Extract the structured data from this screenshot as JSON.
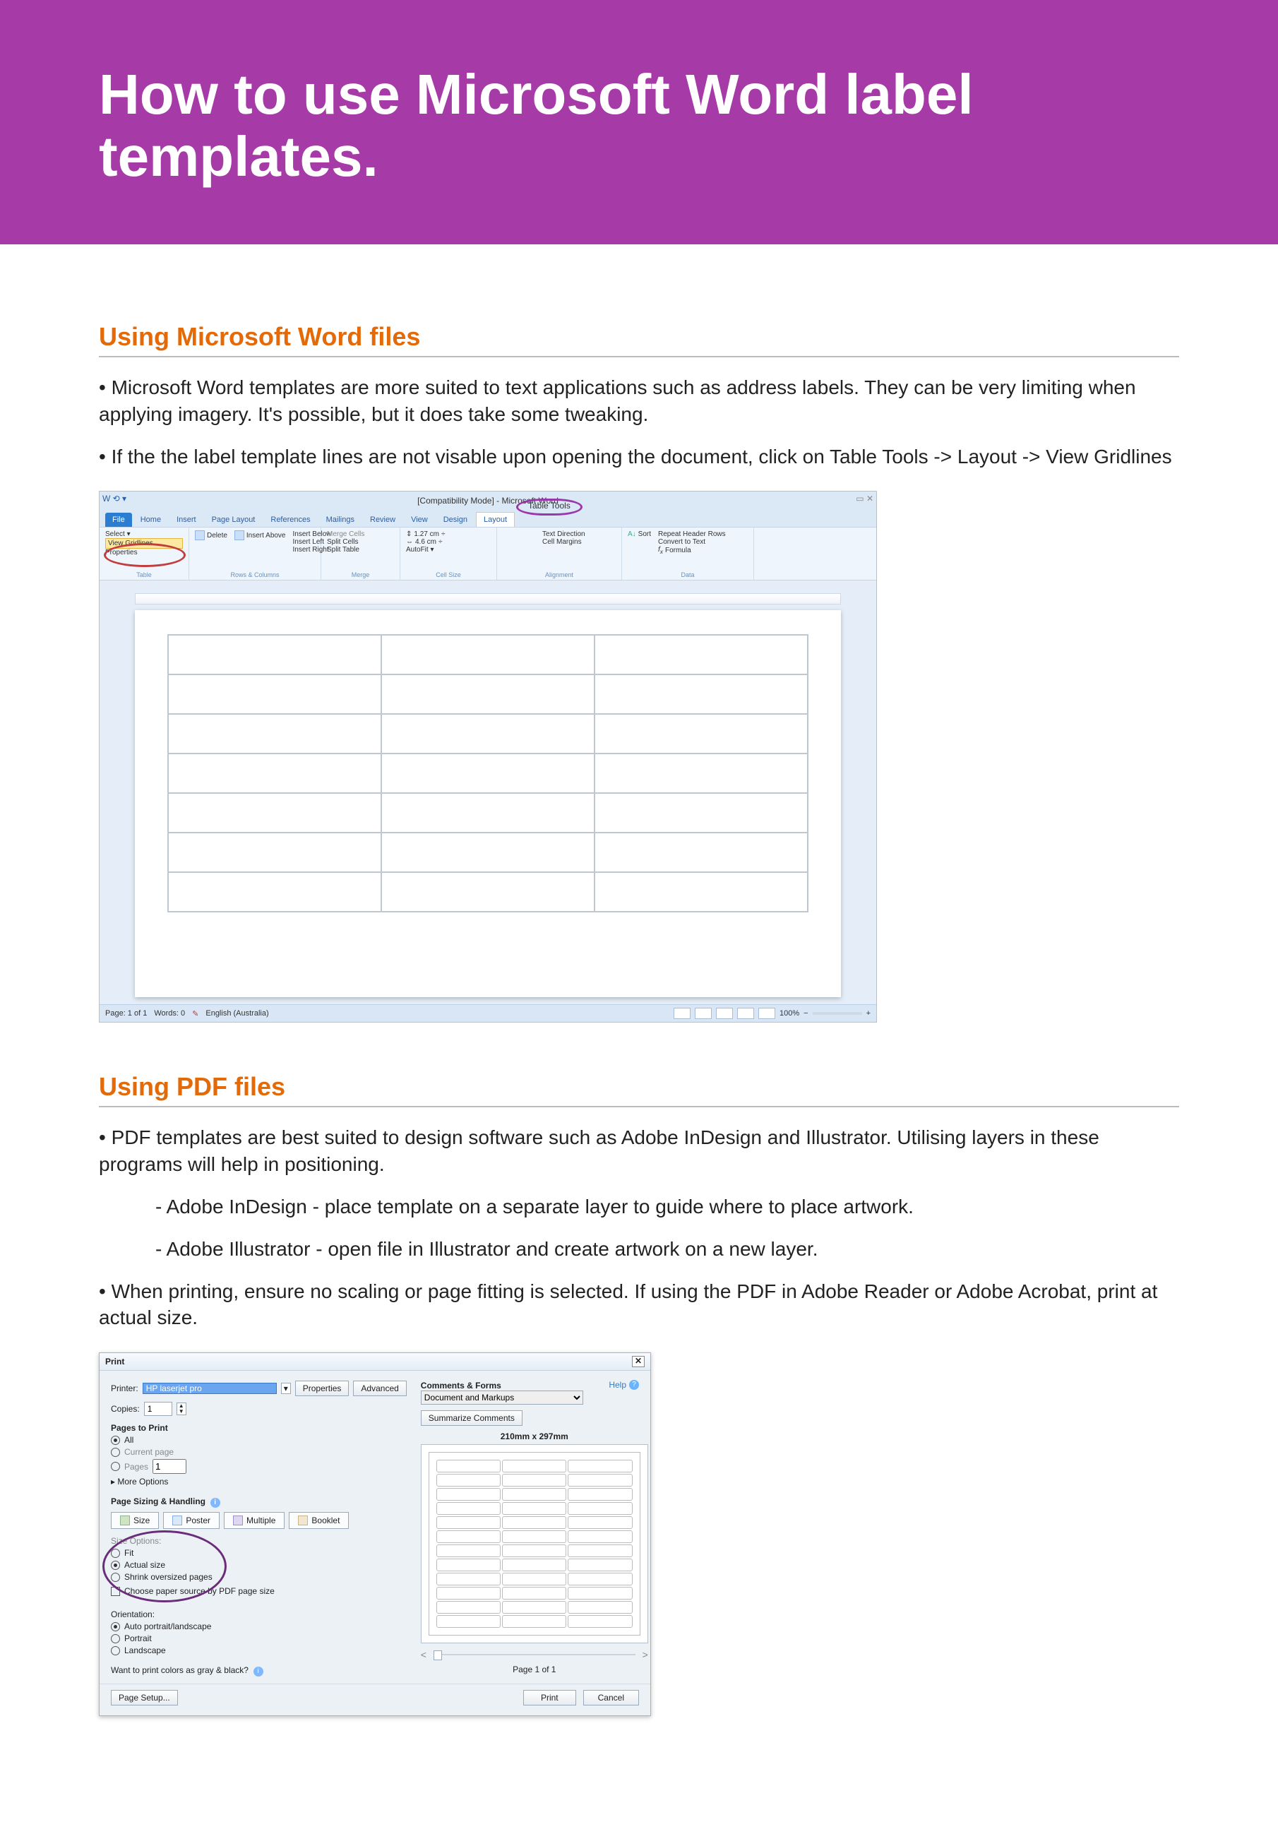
{
  "hero": {
    "title": "How to use Microsoft Word label templates."
  },
  "section1": {
    "heading": "Using Microsoft Word files",
    "p1": "• Microsoft Word templates are more suited to text applications such as address labels. They can be very limiting when applying imagery. It's possible, but it does take some tweaking.",
    "p2": "• If the the label template lines are not visable upon opening the document, click on Table Tools -> Layout -> View Gridlines"
  },
  "word": {
    "title": "[Compatibility Mode] - Microsoft Word",
    "extraTabGroup": "Table Tools",
    "tabs": {
      "file": "File",
      "home": "Home",
      "insert": "Insert",
      "pagelayout": "Page Layout",
      "references": "References",
      "mailings": "Mailings",
      "review": "Review",
      "view": "View",
      "design": "Design",
      "layout": "Layout"
    },
    "ribbon": {
      "table": {
        "select": "Select ▾",
        "viewGridlines": "View Gridlines",
        "properties": "Properties",
        "group": "Table"
      },
      "rowsCols": {
        "delete": "Delete",
        "insertAbove": "Insert Above",
        "below": "Insert Below",
        "left": "Insert Left",
        "right": "Insert Right",
        "group": "Rows & Columns"
      },
      "merge": {
        "mergeCells": "Merge Cells",
        "splitCells": "Split Cells",
        "splitTable": "Split Table",
        "group": "Merge"
      },
      "cellSize": {
        "h": "1.27 cm",
        "w": "4.6 cm",
        "autofit": "AutoFit ▾",
        "group": "Cell Size"
      },
      "alignment": {
        "textDir": "Text Direction",
        "cellMargins": "Cell Margins",
        "group": "Alignment"
      },
      "data": {
        "sort": "Sort",
        "repeat": "Repeat Header Rows",
        "convert": "Convert to Text",
        "formula": "Formula",
        "group": "Data"
      }
    },
    "status": {
      "page": "Page: 1 of 1",
      "words": "Words: 0",
      "lang": "English (Australia)",
      "zoom": "100%"
    }
  },
  "section2": {
    "heading": "Using PDF files",
    "p1": "• PDF templates are best suited to design software such as Adobe InDesign and Illustrator. Utilising layers in these programs will help in positioning.",
    "sub1": "- Adobe InDesign - place template on a separate layer to guide where to place artwork.",
    "sub2": "- Adobe Illustrator - open file in Illustrator and create artwork on a new layer.",
    "p2": "• When printing, ensure no scaling or page fitting is selected. If using the PDF in Adobe Reader or Adobe Acrobat, print at actual size."
  },
  "print": {
    "title": "Print",
    "printerLabel": "Printer:",
    "printerValue": "HP laserjet pro",
    "properties": "Properties",
    "advanced": "Advanced",
    "help": "Help",
    "copiesLabel": "Copies:",
    "copiesValue": "1",
    "pagesHeading": "Pages to Print",
    "radioAll": "All",
    "radioCurrent": "Current page",
    "radioPages": "Pages",
    "pagesValue": "1",
    "moreOptions": "▸  More Options",
    "sizingHeading": "Page Sizing & Handling",
    "btnSize": "Size",
    "btnPoster": "Poster",
    "btnMultiple": "Multiple",
    "btnBooklet": "Booklet",
    "sizeOptions": "Size Options:",
    "fit": "Fit",
    "actual": "Actual size",
    "shrink": "Shrink oversized pages",
    "choose": "Choose paper source by PDF page size",
    "orientationHeading": "Orientation:",
    "oAuto": "Auto portrait/landscape",
    "oPortrait": "Portrait",
    "oLand": "Landscape",
    "grayQ": "Want to print colors as gray & black?",
    "commentsHeading": "Comments & Forms",
    "commentsValue": "Document and Markups",
    "summarize": "Summarize Comments",
    "dims": "210mm x 297mm",
    "pageOf": "Page 1 of 1",
    "pageSetup": "Page Setup...",
    "printBtn": "Print",
    "cancelBtn": "Cancel"
  }
}
